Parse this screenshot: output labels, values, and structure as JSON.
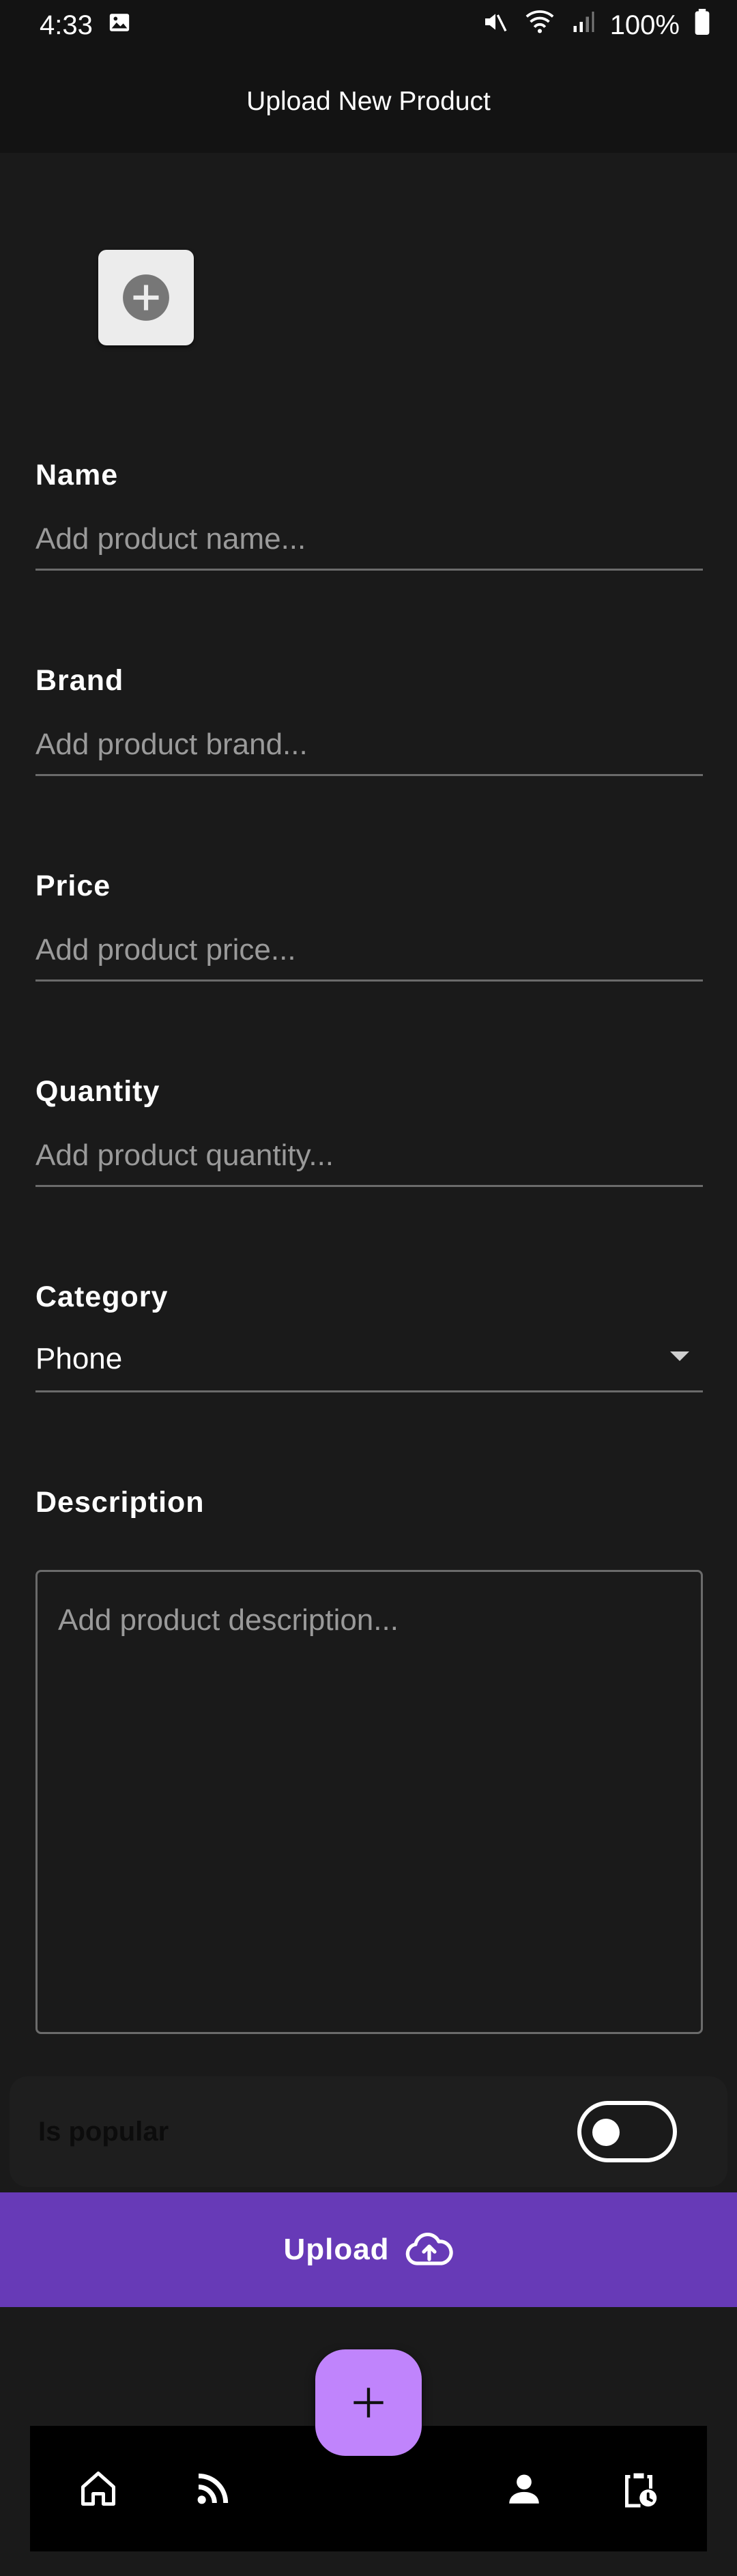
{
  "status_bar": {
    "time": "4:33",
    "battery": "100%"
  },
  "app_bar": {
    "title": "Upload New Product"
  },
  "form": {
    "name": {
      "label": "Name",
      "placeholder": "Add product name..."
    },
    "brand": {
      "label": "Brand",
      "placeholder": "Add product brand..."
    },
    "price": {
      "label": "Price",
      "placeholder": "Add product price..."
    },
    "quantity": {
      "label": "Quantity",
      "placeholder": "Add product quantity..."
    },
    "category": {
      "label": "Category",
      "value": "Phone"
    },
    "description": {
      "label": "Description",
      "placeholder": "Add product description..."
    },
    "popular": {
      "label": "Is popular",
      "enabled": false
    }
  },
  "upload": {
    "label": "Upload"
  },
  "colors": {
    "accent": "#673ab7",
    "fab": "#c084fc",
    "background": "#1a1a1a"
  },
  "icons": {
    "image_picker": "add-circle-icon",
    "upload": "cloud-upload-icon",
    "fab": "plus-icon",
    "nav": [
      "home-icon",
      "feed-icon",
      "person-icon",
      "clipboard-clock-icon"
    ]
  }
}
